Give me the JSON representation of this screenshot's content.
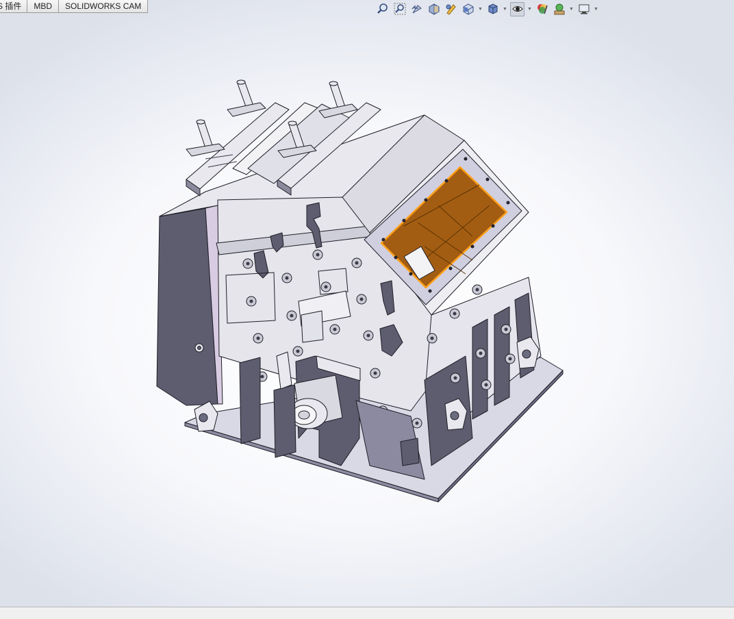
{
  "tabs": [
    {
      "label": "S 插件"
    },
    {
      "label": "MBD"
    },
    {
      "label": "SOLIDWORKS CAM"
    }
  ],
  "view_toolbar": {
    "buttons": [
      {
        "icon": "zoom-to-fit-icon"
      },
      {
        "icon": "zoom-to-area-icon"
      },
      {
        "icon": "previous-view-icon"
      },
      {
        "icon": "section-view-icon"
      },
      {
        "icon": "dynamic-annotation-icon"
      },
      {
        "icon": "view-orientation-icon"
      },
      {
        "icon": "display-style-icon"
      },
      {
        "icon": "hide-show-items-icon"
      },
      {
        "icon": "edit-appearance-icon"
      },
      {
        "icon": "apply-scene-icon"
      },
      {
        "icon": "view-settings-icon"
      }
    ]
  },
  "colors": {
    "part_face": "#e9e8ee",
    "part_shadow": "#5e5d6f",
    "part_edge": "#1d1d26",
    "opening_orange": "#a35d12",
    "opening_edge": "#ffa11c",
    "accent_lavender": "#d8cce2",
    "base_plate": "#d9d9e6"
  }
}
